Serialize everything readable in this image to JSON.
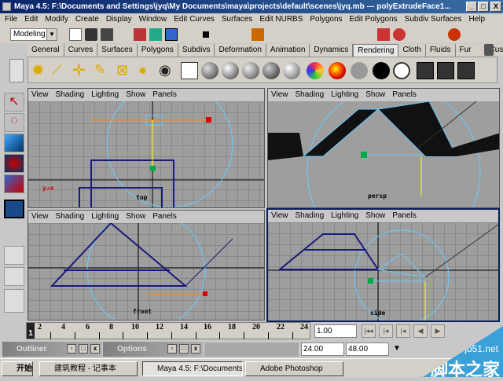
{
  "window": {
    "title": "Maya 4.5: F:\\Documents and Settings\\jyq\\My Documents\\maya\\projects\\default\\scenes\\jyq.mb  ---  polyExtrudeFace1...",
    "min": "_",
    "max": "□",
    "close": "X"
  },
  "menu": [
    "File",
    "Edit",
    "Modify",
    "Create",
    "Display",
    "Window",
    "Edit Curves",
    "Surfaces",
    "Edit NURBS",
    "Polygons",
    "Edit Polygons",
    "Subdiv Surfaces",
    "Help"
  ],
  "toolbar": {
    "mode": "Modeling"
  },
  "shelf_tabs": [
    "General",
    "Curves",
    "Surfaces",
    "Polygons",
    "Subdivs",
    "Deformation",
    "Animation",
    "Dynamics",
    "Rendering",
    "Cloth",
    "Fluids",
    "Fur",
    "Custom"
  ],
  "active_tab": "Rendering",
  "viewports": [
    {
      "menu": [
        "View",
        "Shading",
        "Lighting",
        "Show",
        "Panels"
      ],
      "camera": "top"
    },
    {
      "menu": [
        "View",
        "Shading",
        "Lighting",
        "Show",
        "Panels"
      ],
      "camera": "persp"
    },
    {
      "menu": [
        "View",
        "Shading",
        "Lighting",
        "Show",
        "Panels"
      ],
      "camera": "front"
    },
    {
      "menu": [
        "View",
        "Shading",
        "Lighting",
        "Show",
        "Panels"
      ],
      "camera": "side"
    }
  ],
  "timeline": {
    "ticks": [
      "2",
      "4",
      "6",
      "8",
      "10",
      "12",
      "14",
      "16",
      "18",
      "20",
      "22",
      "24"
    ],
    "current": "1",
    "current_time": "1.00"
  },
  "range": {
    "end": "24.00",
    "max": "48.00"
  },
  "mini_windows": [
    {
      "label": "Outliner"
    },
    {
      "label": "Options"
    }
  ],
  "taskbar": {
    "start": "开始",
    "tasks": [
      "建筑教程 - 记事本",
      "Maya 4.5: F:\\Documents...",
      "Adobe Photoshop"
    ]
  },
  "watermark": {
    "site": "jb51.net",
    "name": "脚本之家"
  }
}
